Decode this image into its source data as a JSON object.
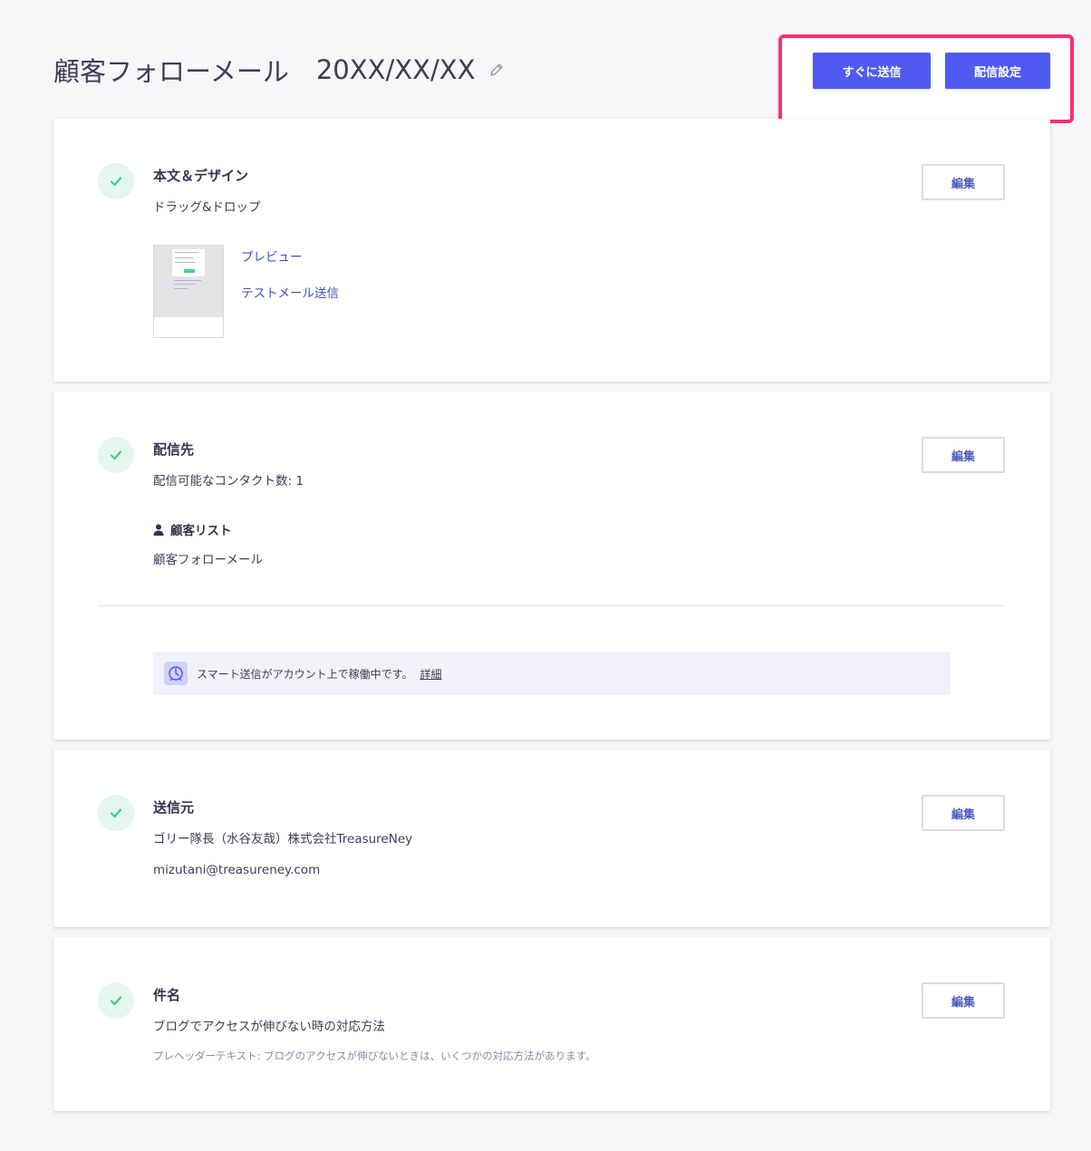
{
  "header": {
    "title": "顧客フォローメール",
    "date": "20XX/XX/XX",
    "send_now_label": "すぐに送信",
    "delivery_settings_label": "配信設定"
  },
  "sections": {
    "content": {
      "title": "本文＆デザイン",
      "subtitle": "ドラッグ&ドロップ",
      "preview_link": "プレビュー",
      "test_mail_link": "テストメール送信",
      "edit_label": "編集"
    },
    "recipients": {
      "title": "配信先",
      "contact_count": "配信可能なコンタクト数: 1",
      "list_heading": "顧客リスト",
      "list_name": "顧客フォローメール",
      "notice_text": "スマート送信がアカウント上で稼働中です。",
      "notice_link": "詳細",
      "edit_label": "編集"
    },
    "sender": {
      "title": "送信元",
      "name": "ゴリー隊長（水谷友哉）株式会社TreasureNey",
      "email": "mizutani@treasureney.com",
      "edit_label": "編集"
    },
    "subject": {
      "title": "件名",
      "subject_text": "ブログでアクセスが伸びない時の対応方法",
      "preheader": "プレヘッダーテキスト: ブログのアクセスが伸びないときは、いくつかの対応方法があります。",
      "edit_label": "編集"
    }
  },
  "icons": {
    "pencil": "pencil-icon",
    "check": "check-icon",
    "person": "person-icon",
    "smart_send": "smart-send-icon"
  },
  "colors": {
    "primary": "#4f5bf0",
    "highlight": "#ff2e74",
    "success": "#3ccf8e",
    "link": "#3e52c2"
  }
}
